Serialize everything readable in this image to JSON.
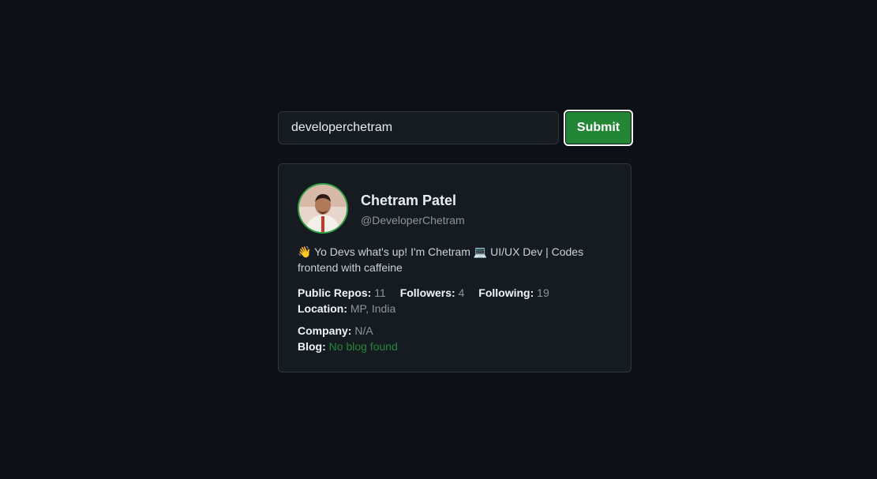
{
  "search": {
    "value": "developerchetram",
    "submit_label": "Submit"
  },
  "profile": {
    "name": "Chetram Patel",
    "handle": "@DeveloperChetram",
    "bio_line1": "👋 Yo Devs what's up! I'm Chetram 💻 UI/UX Dev | Codes",
    "bio_line2": "frontend with caffeine",
    "public_repos_label": "Public Repos:",
    "public_repos": "11",
    "followers_label": "Followers:",
    "followers": "4",
    "following_label": "Following:",
    "following": "19",
    "location_label": "Location:",
    "location": "MP, India",
    "company_label": "Company:",
    "company": "N/A",
    "blog_label": "Blog:",
    "blog": "No blog found"
  },
  "colors": {
    "background": "#0d1117",
    "card": "#161b22",
    "border": "#30363d",
    "accent_green": "#238636",
    "muted": "#8b949e"
  }
}
